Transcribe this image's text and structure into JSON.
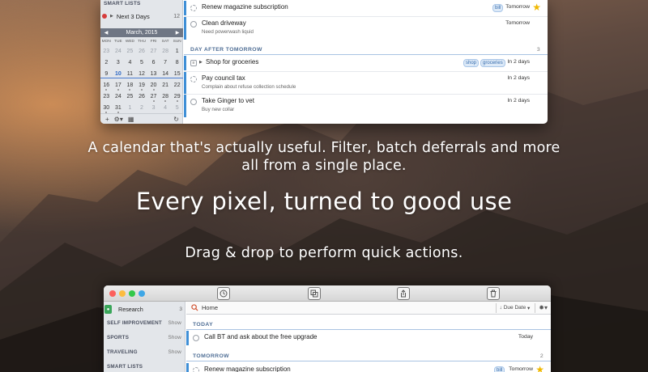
{
  "top_window": {
    "sidebar": {
      "section_title": "SMART LISTS",
      "next_item": {
        "label": "Next 3 Days",
        "count": "12"
      },
      "calendar": {
        "month_label": "March, 2015",
        "weekdays": [
          "MON",
          "TUE",
          "WED",
          "THU",
          "FRI",
          "SAT",
          "SUN"
        ],
        "weeks": [
          [
            "23",
            "24",
            "25",
            "26",
            "27",
            "28",
            "1"
          ],
          [
            "2",
            "3",
            "4",
            "5",
            "6",
            "7",
            "8"
          ],
          [
            "9",
            "10",
            "11",
            "12",
            "13",
            "14",
            "15"
          ],
          [
            "16",
            "17",
            "18",
            "19",
            "20",
            "21",
            "22"
          ],
          [
            "23",
            "24",
            "25",
            "26",
            "27",
            "28",
            "29"
          ],
          [
            "30",
            "31",
            "1",
            "2",
            "3",
            "4",
            "5"
          ]
        ]
      }
    },
    "tasks_top": [
      {
        "title": "Renew magazine subscription",
        "tags": [
          "bill"
        ],
        "due": "Tomorrow"
      },
      {
        "title": "Clean driveway",
        "note": "Need powerwash liquid",
        "due": "Tomorrow"
      }
    ],
    "group": {
      "label": "DAY AFTER TOMORROW",
      "count": "3"
    },
    "tasks_group": [
      {
        "title": "Shop for groceries",
        "tags": [
          "shop",
          "groceries"
        ],
        "due": "In 2 days"
      },
      {
        "title": "Pay council tax",
        "note": "Complain about refuse collection schedule",
        "due": "In 2 days"
      },
      {
        "title": "Take Ginger to vet",
        "note": "Buy new collar",
        "due": "In 2 days"
      }
    ]
  },
  "captions": {
    "line1": "A calendar that's actually useful. Filter, batch deferrals and more",
    "line1b": "all from a single place.",
    "line2": "Every pixel, turned to good use",
    "line3": "Drag & drop to perform quick actions."
  },
  "bottom_window": {
    "toolbar_icons": [
      "clock-icon",
      "duplicate-icon",
      "share-icon",
      "trash-icon"
    ],
    "sidebar": {
      "research": {
        "label": "Research",
        "count": "3"
      },
      "sections": [
        {
          "label": "SELF IMPROVEMENT",
          "action": "Show"
        },
        {
          "label": "SPORTS",
          "action": "Show"
        },
        {
          "label": "TRAVELING",
          "action": "Show"
        },
        {
          "label": "SMART LISTS",
          "action": ""
        }
      ]
    },
    "search": {
      "value": "Home",
      "sort_label": "Due Date"
    },
    "today_group": {
      "label": "TODAY",
      "count": ""
    },
    "today_task": {
      "title": "Call BT and ask about the free upgrade",
      "due": "Today"
    },
    "tomorrow_group": {
      "label": "TOMORROW",
      "count": "2"
    },
    "tomorrow_task": {
      "title": "Renew magazine subscription",
      "tags": [
        "bill"
      ],
      "due": "Tomorrow"
    }
  },
  "colors": {
    "accent": "#3f8fd6",
    "overdue_dot": "#d63c3c",
    "star": "#f0b800",
    "list_green": "#3aa65a"
  }
}
